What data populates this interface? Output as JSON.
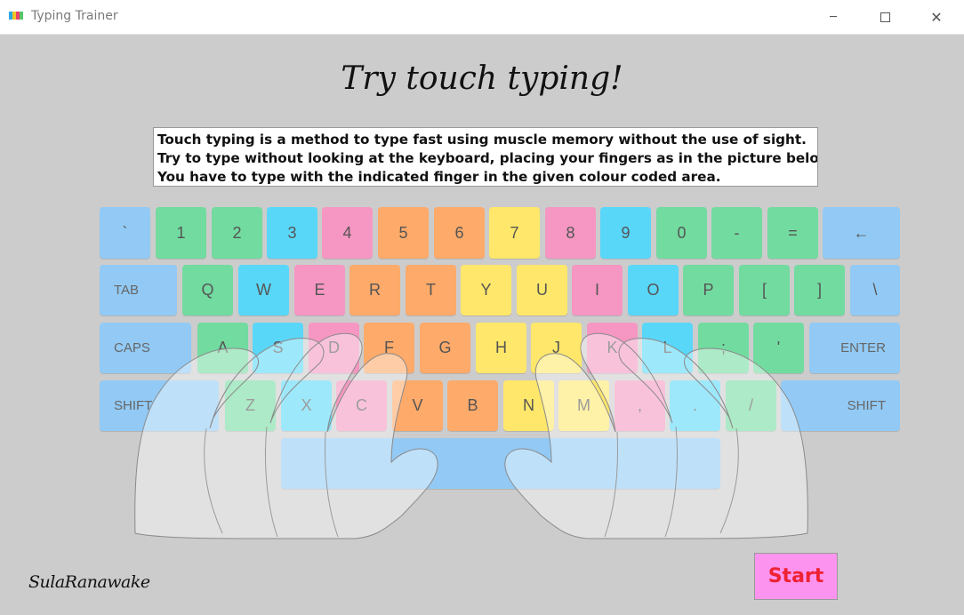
{
  "window": {
    "title": "Typing Trainer",
    "minimize_glyph": "─",
    "close_glyph": "✕"
  },
  "headline": "Try touch typing!",
  "intro": {
    "lines": [
      "Touch typing is a method to type fast using muscle memory without the use of sight.",
      "Try to type without looking at the keyboard, placing your fingers as in the picture below.",
      "You have to type with the indicated finger in the given colour coded area."
    ]
  },
  "colors": {
    "app_background": "#cccccc",
    "blue": "#92caf5",
    "green": "#72dba0",
    "cyan": "#59d7f9",
    "pink": "#f597c2",
    "orange": "#fdaa6a",
    "yellow": "#fee76a",
    "start_background": "#fc93ee",
    "start_text": "#ee2233"
  },
  "keyboard": {
    "rows": [
      [
        {
          "label": "`",
          "finger": "blue"
        },
        {
          "label": "1",
          "finger": "green"
        },
        {
          "label": "2",
          "finger": "green"
        },
        {
          "label": "3",
          "finger": "cyan"
        },
        {
          "label": "4",
          "finger": "pink"
        },
        {
          "label": "5",
          "finger": "orange"
        },
        {
          "label": "6",
          "finger": "orange"
        },
        {
          "label": "7",
          "finger": "yellow"
        },
        {
          "label": "8",
          "finger": "pink"
        },
        {
          "label": "9",
          "finger": "cyan"
        },
        {
          "label": "0",
          "finger": "green"
        },
        {
          "label": "-",
          "finger": "green"
        },
        {
          "label": "=",
          "finger": "green"
        },
        {
          "label": "←",
          "finger": "blue"
        }
      ],
      [
        {
          "label": "TAB",
          "finger": "blue"
        },
        {
          "label": "Q",
          "finger": "green"
        },
        {
          "label": "W",
          "finger": "cyan"
        },
        {
          "label": "E",
          "finger": "pink"
        },
        {
          "label": "R",
          "finger": "orange"
        },
        {
          "label": "T",
          "finger": "orange"
        },
        {
          "label": "Y",
          "finger": "yellow"
        },
        {
          "label": "U",
          "finger": "yellow"
        },
        {
          "label": "I",
          "finger": "pink"
        },
        {
          "label": "O",
          "finger": "cyan"
        },
        {
          "label": "P",
          "finger": "green"
        },
        {
          "label": "[",
          "finger": "green"
        },
        {
          "label": "]",
          "finger": "green"
        },
        {
          "label": "\\",
          "finger": "blue"
        }
      ],
      [
        {
          "label": "CAPS",
          "finger": "blue"
        },
        {
          "label": "A",
          "finger": "green"
        },
        {
          "label": "S",
          "finger": "cyan"
        },
        {
          "label": "D",
          "finger": "pink"
        },
        {
          "label": "F",
          "finger": "orange"
        },
        {
          "label": "G",
          "finger": "orange"
        },
        {
          "label": "H",
          "finger": "yellow"
        },
        {
          "label": "J",
          "finger": "yellow"
        },
        {
          "label": "K",
          "finger": "pink"
        },
        {
          "label": "L",
          "finger": "cyan"
        },
        {
          "label": ";",
          "finger": "green"
        },
        {
          "label": "'",
          "finger": "green"
        },
        {
          "label": "ENTER",
          "finger": "blue"
        }
      ],
      [
        {
          "label": "SHIFT",
          "finger": "blue"
        },
        {
          "label": "Z",
          "finger": "green"
        },
        {
          "label": "X",
          "finger": "cyan"
        },
        {
          "label": "C",
          "finger": "pink"
        },
        {
          "label": "V",
          "finger": "orange"
        },
        {
          "label": "B",
          "finger": "orange"
        },
        {
          "label": "N",
          "finger": "yellow"
        },
        {
          "label": "M",
          "finger": "yellow"
        },
        {
          "label": ",",
          "finger": "pink"
        },
        {
          "label": ".",
          "finger": "cyan"
        },
        {
          "label": "/",
          "finger": "green"
        },
        {
          "label": "SHIFT",
          "finger": "blue"
        }
      ],
      [
        {
          "label": "",
          "finger": "blue"
        }
      ]
    ]
  },
  "signature": "SulaRanawake",
  "start_button": {
    "label": "Start"
  }
}
